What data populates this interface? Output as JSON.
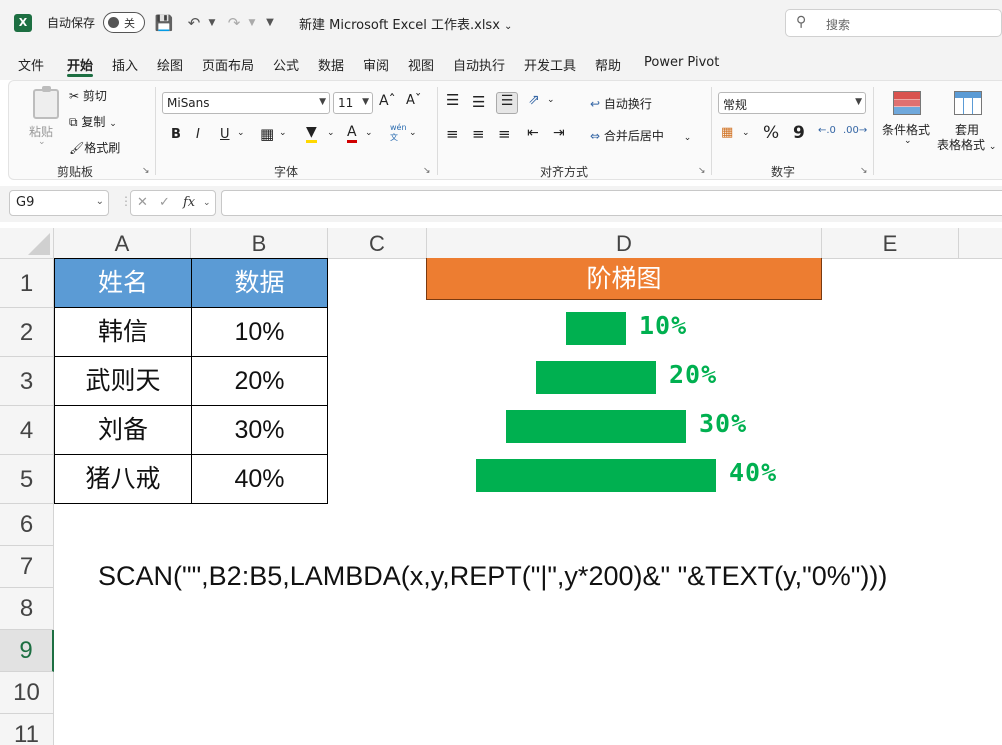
{
  "titlebar": {
    "app_logo": "X",
    "autosave_label": "自动保存",
    "autosave_state": "关",
    "filename": "新建 Microsoft Excel 工作表.xlsx",
    "search_placeholder": "搜索",
    "icons": [
      "save-icon",
      "undo-icon",
      "redo-icon",
      "customize-icon"
    ]
  },
  "menu": {
    "tabs": [
      "文件",
      "开始",
      "插入",
      "绘图",
      "页面布局",
      "公式",
      "数据",
      "审阅",
      "视图",
      "自动执行",
      "开发工具",
      "帮助",
      "Power Pivot"
    ],
    "active": "开始"
  },
  "ribbon": {
    "clipboard": {
      "paste": "粘贴",
      "cut": "剪切",
      "copy": "复制",
      "format_painter": "格式刷",
      "label": "剪贴板"
    },
    "font": {
      "name": "MiSans",
      "size": "11",
      "bold": "B",
      "italic": "I",
      "underline": "U",
      "label": "字体"
    },
    "alignment": {
      "wrap": "自动换行",
      "merge": "合并后居中",
      "label": "对齐方式"
    },
    "number": {
      "format": "常规",
      "percent": "%",
      "comma": "9",
      "label": "数字"
    },
    "styles": {
      "conditional": "条件格式",
      "table_l1": "套用",
      "table_l2": "表格格式"
    }
  },
  "formula_bar": {
    "name_box": "G9",
    "fx": "fx",
    "content": ""
  },
  "grid": {
    "columns": [
      "A",
      "B",
      "C",
      "D",
      "E"
    ],
    "rows": [
      "1",
      "2",
      "3",
      "4",
      "5",
      "6",
      "7",
      "8",
      "9",
      "10",
      "11"
    ],
    "selected_row": "9",
    "table": {
      "headers": [
        "姓名",
        "数据"
      ],
      "rows": [
        {
          "name": "韩信",
          "value": "10%"
        },
        {
          "name": "武则天",
          "value": "20%"
        },
        {
          "name": "刘备",
          "value": "30%"
        },
        {
          "name": "猪八戒",
          "value": "40%"
        }
      ]
    },
    "ladder": {
      "title": "阶梯图",
      "bars": [
        {
          "value": 0.1,
          "label": "10%"
        },
        {
          "value": 0.2,
          "label": "20%"
        },
        {
          "value": 0.3,
          "label": "30%"
        },
        {
          "value": 0.4,
          "label": "40%"
        }
      ]
    },
    "formula_note": "SCAN(\"\",B2:B5,LAMBDA(x,y,REPT(\"|\",y*200)&\"  \"&TEXT(y,\"0%\")))"
  },
  "colors": {
    "header_blue": "#5b9bd5",
    "title_orange": "#ed7d31",
    "bar_green": "#00b050",
    "excel_green": "#1d6f42"
  }
}
